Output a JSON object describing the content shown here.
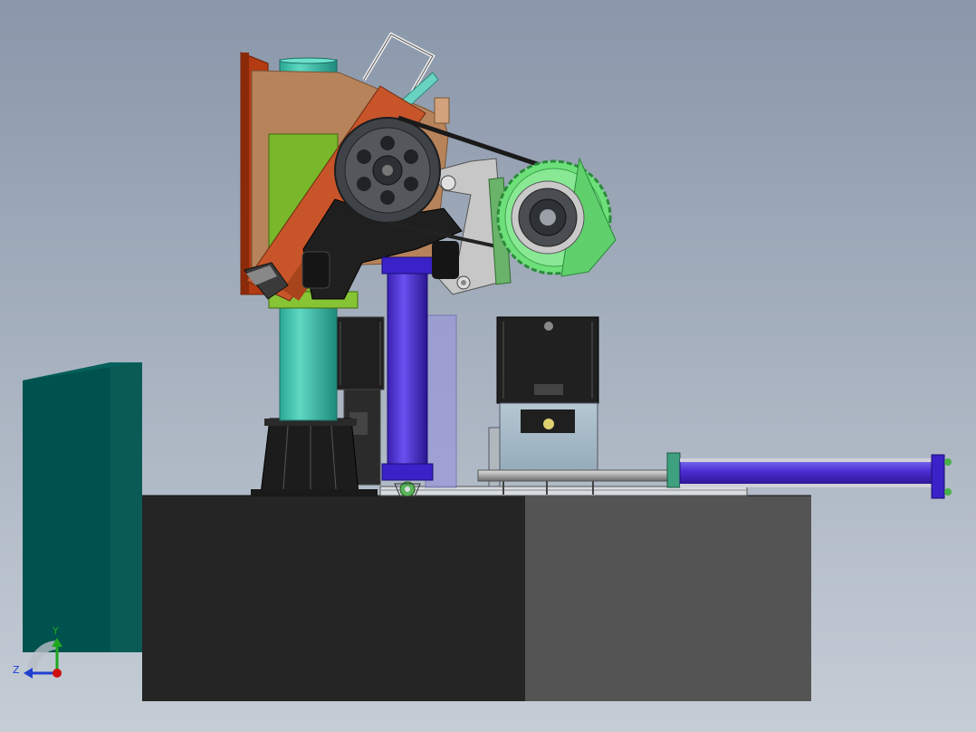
{
  "viewport": {
    "background_top": "#8a97aa",
    "background_bottom": "#c5cdd6"
  },
  "triad": {
    "y_label": "Y",
    "z_label": "Z",
    "y_color": "#1ea81e",
    "z_color": "#2040d0",
    "x_color": "#d01010"
  },
  "colors": {
    "column": "#3bbfaa",
    "cylinder": "#4a2bd0",
    "pulley": "#3f4347",
    "green_pulley": "#6ee07a",
    "orange_plate": "#c8552a",
    "green_block": "#78b82a",
    "tan_plate": "#b7835b",
    "cabinet": "#00524f",
    "base_dark": "#252525",
    "base_mid": "#545454"
  }
}
